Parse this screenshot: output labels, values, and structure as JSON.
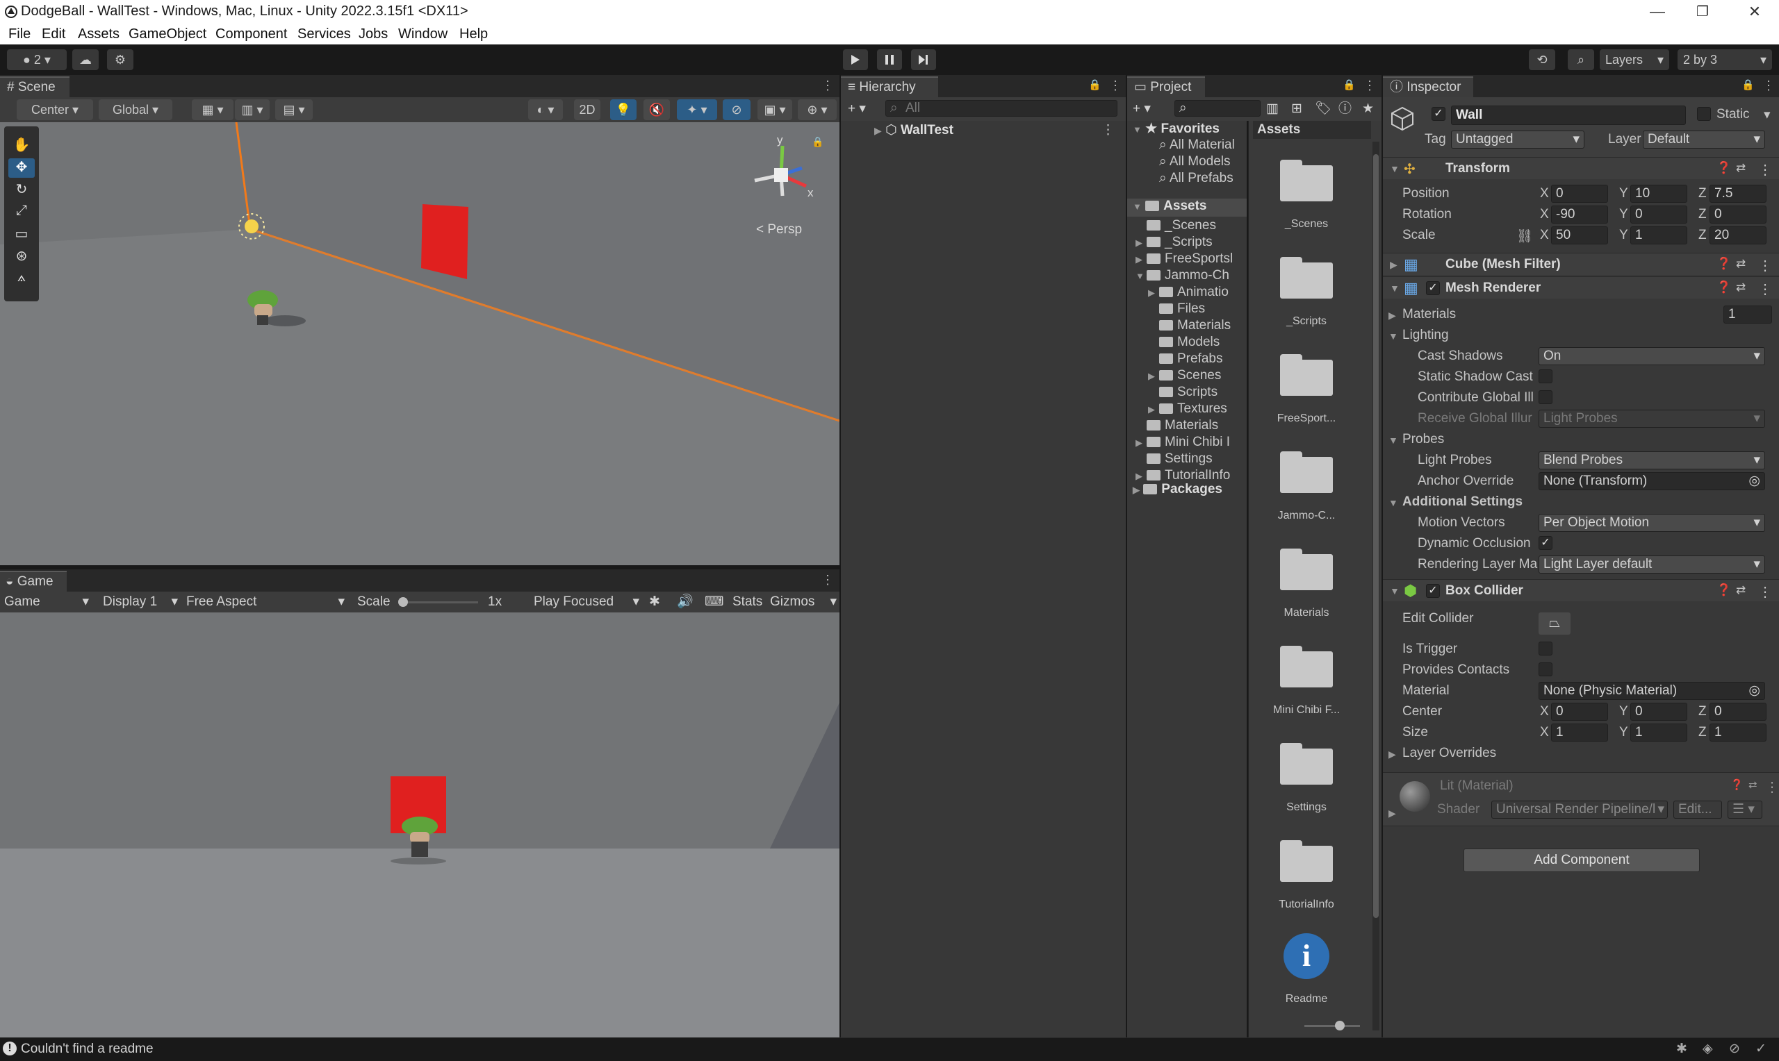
{
  "window": {
    "title": "DodgeBall - WallTest - Windows, Mac, Linux - Unity 2022.3.15f1 <DX11>",
    "minimize": "—",
    "maximize": "❐",
    "close": "✕"
  },
  "menu": [
    "File",
    "Edit",
    "Assets",
    "GameObject",
    "Component",
    "Services",
    "Jobs",
    "Window",
    "Help"
  ],
  "toolbar": {
    "account_label": "2",
    "layers_label": "Layers",
    "layout_label": "2 by 3"
  },
  "scene": {
    "tab": "Scene",
    "pivot": "Center",
    "space": "Global",
    "mode2d": "2D",
    "persp": "< Persp",
    "gizmo_y": "y",
    "gizmo_x": "x"
  },
  "game": {
    "tab": "Game",
    "view": "Game",
    "display": "Display 1",
    "aspect": "Free Aspect",
    "scale_label": "Scale",
    "scale_value": "1x",
    "play_mode": "Play Focused",
    "stats": "Stats",
    "gizmos": "Gizmos"
  },
  "hierarchy": {
    "tab": "Hierarchy",
    "search_placeholder": "All",
    "scene_name": "WallTest"
  },
  "project": {
    "tab": "Project",
    "favorites_label": "Favorites",
    "favorites": [
      "All Material",
      "All Models",
      "All Prefabs"
    ],
    "assets_label": "Assets",
    "tree": [
      {
        "label": "_Scenes",
        "indent": 1,
        "arrow": false
      },
      {
        "label": "_Scripts",
        "indent": 1,
        "arrow": true
      },
      {
        "label": "FreeSportsl",
        "indent": 1,
        "arrow": true
      },
      {
        "label": "Jammo-Ch",
        "indent": 1,
        "arrow": true,
        "open": true
      },
      {
        "label": "Animatio",
        "indent": 2,
        "arrow": true
      },
      {
        "label": "Files",
        "indent": 2,
        "arrow": false
      },
      {
        "label": "Materials",
        "indent": 2,
        "arrow": false
      },
      {
        "label": "Models",
        "indent": 2,
        "arrow": false
      },
      {
        "label": "Prefabs",
        "indent": 2,
        "arrow": false
      },
      {
        "label": "Scenes",
        "indent": 2,
        "arrow": true
      },
      {
        "label": "Scripts",
        "indent": 2,
        "arrow": false
      },
      {
        "label": "Textures",
        "indent": 2,
        "arrow": true
      },
      {
        "label": "Materials",
        "indent": 1,
        "arrow": false
      },
      {
        "label": "Mini Chibi I",
        "indent": 1,
        "arrow": true
      },
      {
        "label": "Settings",
        "indent": 1,
        "arrow": false
      },
      {
        "label": "TutorialInfo",
        "indent": 1,
        "arrow": true
      }
    ],
    "packages_label": "Packages",
    "grid_header": "Assets",
    "grid": [
      "_Scenes",
      "_Scripts",
      "FreeSport...",
      "Jammo-C...",
      "Materials",
      "Mini Chibi F...",
      "Settings",
      "TutorialInfo"
    ],
    "readme": "Readme"
  },
  "inspector": {
    "tab": "Inspector",
    "object_name": "Wall",
    "static_label": "Static",
    "tag_label": "Tag",
    "tag_value": "Untagged",
    "layer_label": "Layer",
    "layer_value": "Default",
    "transform": {
      "title": "Transform",
      "position_label": "Position",
      "position": [
        "0",
        "10",
        "7.5"
      ],
      "rotation_label": "Rotation",
      "rotation": [
        "-90",
        "0",
        "0"
      ],
      "scale_label": "Scale",
      "scale": [
        "50",
        "1",
        "20"
      ]
    },
    "axes": [
      "X",
      "Y",
      "Z"
    ],
    "mesh_filter_title": "Cube (Mesh Filter)",
    "mesh_renderer": {
      "title": "Mesh Renderer",
      "materials_label": "Materials",
      "materials_count": "1",
      "lighting_label": "Lighting",
      "cast_shadows_label": "Cast Shadows",
      "cast_shadows_value": "On",
      "static_shadow_label": "Static Shadow Cast",
      "contribute_gi_label": "Contribute Global Ill",
      "receive_gi_label": "Receive Global Illur",
      "receive_gi_value": "Light Probes",
      "probes_label": "Probes",
      "light_probes_label": "Light Probes",
      "light_probes_value": "Blend Probes",
      "anchor_label": "Anchor Override",
      "anchor_value": "None (Transform)",
      "additional_label": "Additional Settings",
      "motion_label": "Motion Vectors",
      "motion_value": "Per Object Motion",
      "dynamic_occ_label": "Dynamic Occlusion",
      "render_layer_label": "Rendering Layer Ma",
      "render_layer_value": "Light Layer default"
    },
    "box_collider": {
      "title": "Box Collider",
      "edit_label": "Edit Collider",
      "trigger_label": "Is Trigger",
      "contacts_label": "Provides Contacts",
      "material_label": "Material",
      "material_value": "None (Physic Material)",
      "center_label": "Center",
      "center": [
        "0",
        "0",
        "0"
      ],
      "size_label": "Size",
      "size": [
        "1",
        "1",
        "1"
      ],
      "overrides_label": "Layer Overrides"
    },
    "material": {
      "title": "Lit (Material)",
      "shader_label": "Shader",
      "shader_value": "Universal Render Pipeline/l",
      "edit_label": "Edit..."
    },
    "add_component": "Add Component"
  },
  "status": {
    "message": "Couldn't find a readme"
  },
  "colors": {
    "accent": "#2c5d87",
    "wall_red": "#e0201f",
    "selection_orange": "#f27a1a",
    "editor_bg": "#383838"
  }
}
